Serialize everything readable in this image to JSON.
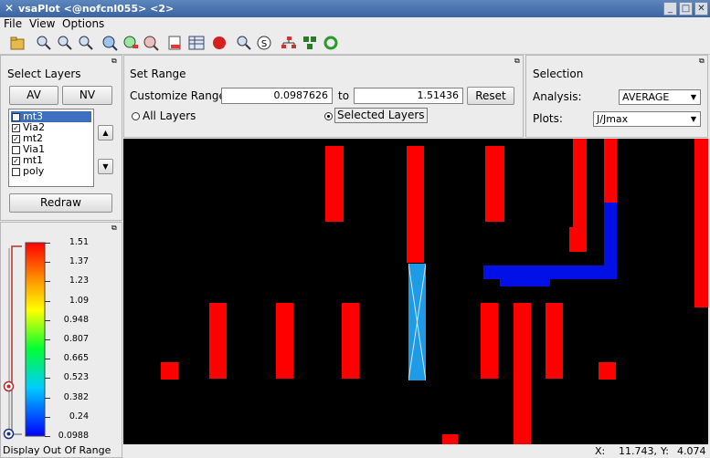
{
  "window": {
    "title": "vsaPlot <@nofcnl055> <2>"
  },
  "menu": {
    "file": "File",
    "view": "View",
    "options": "Options"
  },
  "toolbar_icons": [
    "open-folder-icon",
    "zoom-icon",
    "zoom-in-icon",
    "zoom-out-icon",
    "fit-view-icon",
    "layer-view-icon",
    "zoom-select-icon",
    "report-icon",
    "table-icon",
    "stop-icon",
    "search-icon",
    "refresh-icon",
    "hierarchy-icon",
    "group-icon",
    "recycle-icon"
  ],
  "select_layers": {
    "title": "Select Layers",
    "av_label": "AV",
    "nv_label": "NV",
    "items": [
      {
        "label": "mt3",
        "checked": "✓"
      },
      {
        "label": "Via2",
        "checked": "✓"
      },
      {
        "label": "mt2",
        "checked": "✓"
      },
      {
        "label": "Via1",
        "checked": ""
      },
      {
        "label": "mt1",
        "checked": "✓"
      },
      {
        "label": "poly",
        "checked": ""
      }
    ],
    "redraw_label": "Redraw"
  },
  "set_range": {
    "title": "Set Range",
    "customize_label": "Customize Range",
    "min_value": "0.0987626",
    "to_label": "to",
    "max_value": "1.51436",
    "reset_label": "Reset",
    "all_layers_label": "All Layers",
    "selected_layers_label": "Selected Layers"
  },
  "selection": {
    "title": "Selection",
    "analysis_label": "Analysis:",
    "analysis_value": "AVERAGE",
    "plots_label": "Plots:",
    "plots_value": "J/Jmax"
  },
  "legend": {
    "ticks": [
      "1.51",
      "1.37",
      "1.23",
      "1.09",
      "0.948",
      "0.807",
      "0.665",
      "0.523",
      "0.382",
      "0.24",
      "0.0988"
    ],
    "display_out_of_range_label": "Display Out Of Range"
  },
  "status": {
    "x_label": "X:",
    "x_value": "11.743,",
    "y_label": "Y:",
    "y_value": "4.074"
  },
  "colors": {
    "shape_red": "#ff0000",
    "shape_blue": "#0010e6",
    "shape_cyan": "#1e9be6",
    "canvas": "#000000"
  }
}
